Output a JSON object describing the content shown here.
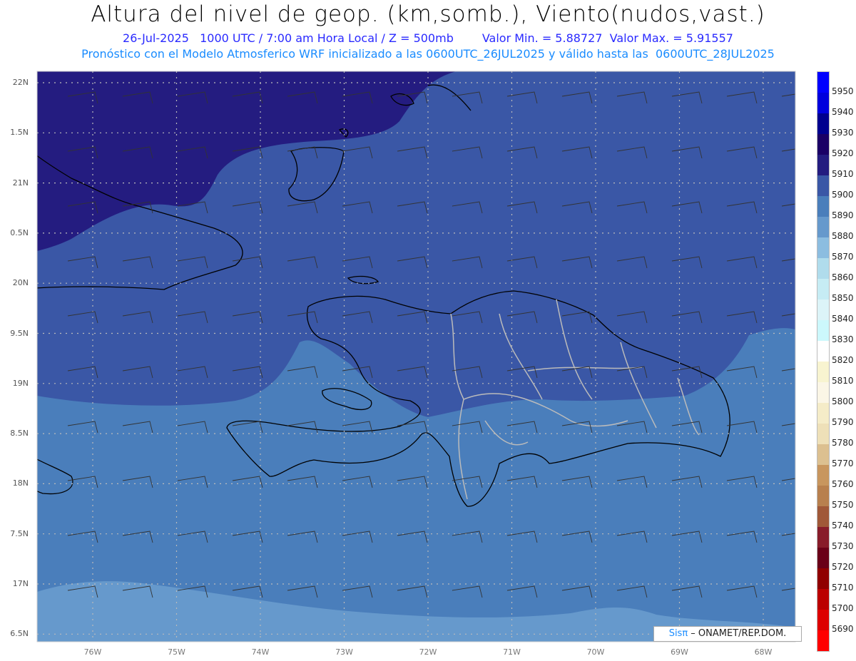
{
  "header": {
    "title": "Altura del nivel de geop. (km,somb.), Viento(nudos,vast.)",
    "datetime": "26-Jul-2025   1000 UTC / 7:00 am Hora Local / Z = 500mb",
    "min_label": "Valor Min. = 5.88727",
    "max_label": "Valor Max. = 5.91557",
    "subtitle": "Pronóstico con el Modelo Atmosferico WRF inicializado a las 0600UTC_26JUL2025 y válido hasta las  0600UTC_28JUL2025"
  },
  "axes": {
    "lat_labels": [
      "22N",
      "1.5N",
      "21N",
      "0.5N",
      "20N",
      "9.5N",
      "19N",
      "8.5N",
      "18N",
      "7.5N",
      "17N",
      "6.5N"
    ],
    "lon_labels": [
      "76W",
      "75W",
      "74W",
      "73W",
      "72W",
      "71W",
      "70W",
      "69W",
      "68W"
    ]
  },
  "colorbar": {
    "labels": [
      "5950",
      "5940",
      "5930",
      "5920",
      "5910",
      "5900",
      "5890",
      "5880",
      "5870",
      "5860",
      "5850",
      "5840",
      "5830",
      "5820",
      "5810",
      "5800",
      "5790",
      "5780",
      "5770",
      "5760",
      "5750",
      "5740",
      "5730",
      "5720",
      "5710",
      "5700",
      "5690"
    ],
    "colors": [
      "#0000ff",
      "#0000dd",
      "#00008f",
      "#1a0066",
      "#241c80",
      "#3a57a6",
      "#4a7ebb",
      "#6699cc",
      "#8cbde0",
      "#b0dcec",
      "#c6ecf4",
      "#dcf4f8",
      "#ccf8fc",
      "#ffffff",
      "#f8f4d0",
      "#fbf6e6",
      "#f5ecc8",
      "#eee0b8",
      "#dcc090",
      "#c8965e",
      "#b8804e",
      "#a05838",
      "#881c2a",
      "#6a0018",
      "#900000",
      "#bb0000",
      "#dd0000",
      "#ff0000"
    ]
  },
  "credit": {
    "brand": "Sisπ",
    "text": " – ONAMET/REP.DOM."
  }
}
